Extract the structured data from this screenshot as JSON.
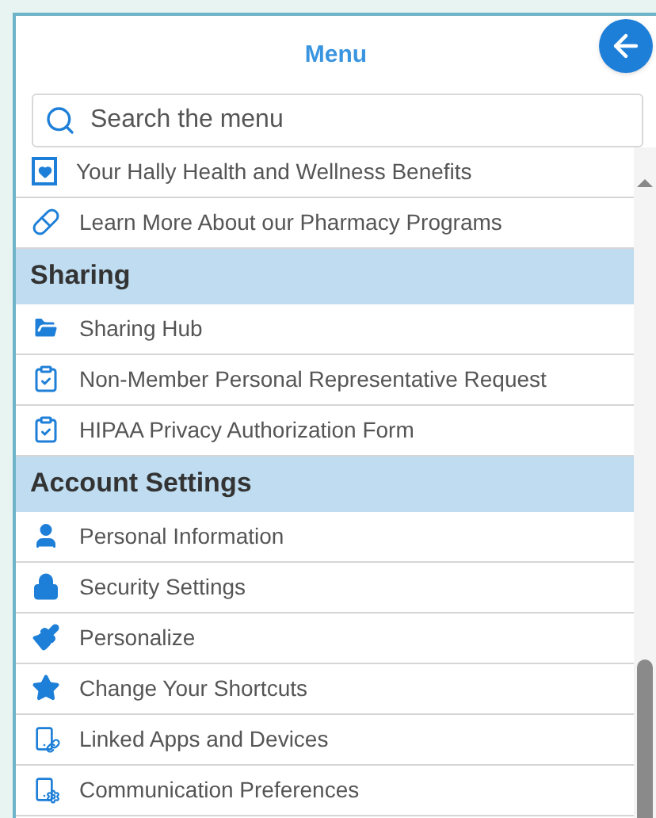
{
  "title": "Menu",
  "search": {
    "placeholder": "Search the menu"
  },
  "menu": [
    {
      "kind": "item",
      "label": "Your Hally Health and Wellness Benefits"
    },
    {
      "kind": "item",
      "label": "Learn More About our Pharmacy Programs"
    },
    {
      "kind": "header",
      "label": "Sharing"
    },
    {
      "kind": "item",
      "label": "Sharing Hub"
    },
    {
      "kind": "item",
      "label": "Non-Member Personal Representative Request"
    },
    {
      "kind": "item",
      "label": "HIPAA Privacy Authorization Form"
    },
    {
      "kind": "header",
      "label": "Account Settings"
    },
    {
      "kind": "item",
      "label": "Personal Information"
    },
    {
      "kind": "item",
      "label": "Security Settings"
    },
    {
      "kind": "item",
      "label": "Personalize"
    },
    {
      "kind": "item",
      "label": "Change Your Shortcuts"
    },
    {
      "kind": "item",
      "label": "Linked Apps and Devices"
    },
    {
      "kind": "item",
      "label": "Communication Preferences"
    }
  ]
}
